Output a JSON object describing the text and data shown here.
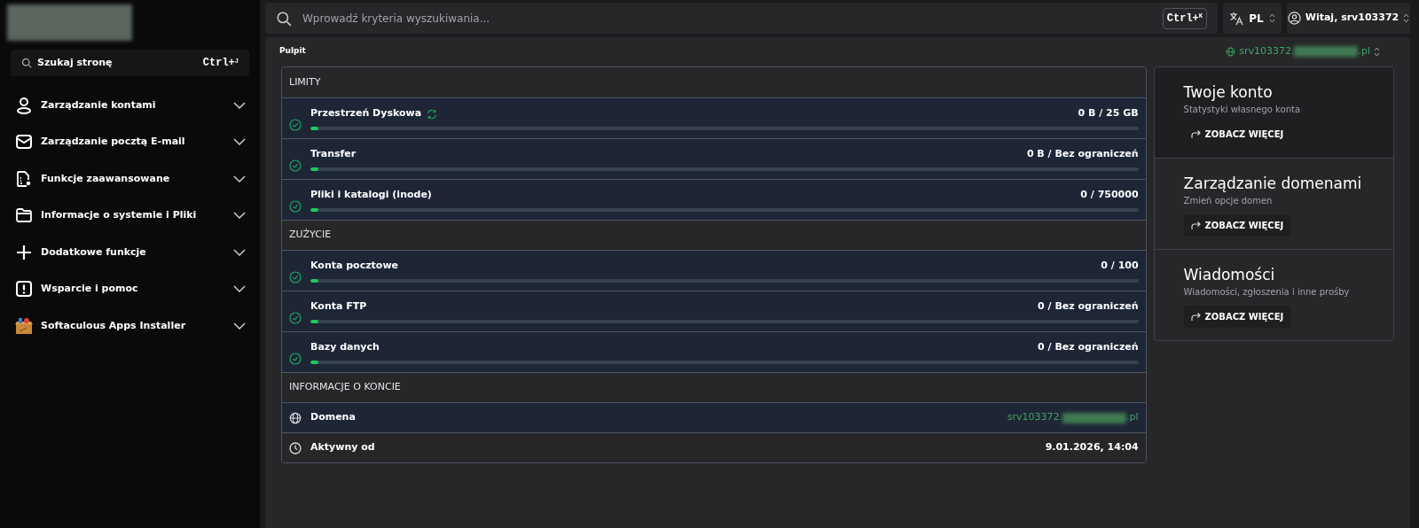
{
  "sidebar": {
    "search": {
      "placeholder": "Szukaj stronę",
      "shortcut": "Ctrl+",
      "shortcut_key": "J"
    },
    "items": [
      {
        "label": "Zarządzanie kontami",
        "expanded": false
      },
      {
        "label": "Zarządzanie pocztą E-mail",
        "expanded": false
      },
      {
        "label": "Funkcje zaawansowane",
        "expanded": false
      },
      {
        "label": "Informacje o systemie i Pliki",
        "expanded": false
      },
      {
        "label": "Dodatkowe funkcje",
        "expanded": false
      },
      {
        "label": "Wsparcie i pomoc",
        "expanded": false
      },
      {
        "label": "Softaculous Apps Installer",
        "expanded": false
      }
    ]
  },
  "topbar": {
    "search": {
      "placeholder": "Wprowadź kryteria wyszukiwania...",
      "shortcut": "Ctrl+",
      "shortcut_key": "K"
    },
    "language": "PL",
    "user": "Witaj, srv103372"
  },
  "breadcrumb": "Pulpit",
  "server": {
    "prefix": "srv103372.",
    "suffix": ".pl"
  },
  "sections": [
    {
      "title": "LIMITY",
      "rows": [
        {
          "label": "Przestrzeń Dyskowa",
          "value": "0 B / 25 GB",
          "level": 0.01,
          "refresh": true
        },
        {
          "label": "Transfer",
          "value": "0 B / Bez ograniczeń",
          "level": 0.01,
          "refresh": false
        },
        {
          "label": "Pliki i katalogi (inode)",
          "value": "0 / 750000",
          "level": 0.01,
          "refresh": false
        }
      ]
    },
    {
      "title": "ZUŻYCIE",
      "rows": [
        {
          "label": "Konta pocztowe",
          "value": "0 / 100",
          "level": 0.01,
          "refresh": false
        },
        {
          "label": "Konta FTP",
          "value": "0 / Bez ograniczeń",
          "level": 0.01,
          "refresh": false
        },
        {
          "label": "Bazy danych",
          "value": "0 / Bez ograniczeń",
          "level": 0.01,
          "refresh": false
        }
      ]
    }
  ],
  "account_info": {
    "title": "INFORMACJE O KONCIE",
    "rows": [
      {
        "kind": "domain",
        "label": "Domena",
        "prefix": "srv103372.",
        "suffix": ".pl"
      },
      {
        "kind": "time",
        "label": "Aktywny od",
        "value": "9.01.2026, 14:04"
      }
    ]
  },
  "cards": [
    {
      "title": "Twoje konto",
      "subtitle": "Statystyki własnego konta",
      "link": "ZOBACZ WIĘCEJ"
    },
    {
      "title": "Zarządzanie domenami",
      "subtitle": "Zmień opcje domen",
      "link": "ZOBACZ WIĘCEJ"
    },
    {
      "title": "Wiadomości",
      "subtitle": "Wiadomości, zgłoszenia i inne prośby",
      "link": "ZOBACZ WIĘCEJ"
    }
  ]
}
